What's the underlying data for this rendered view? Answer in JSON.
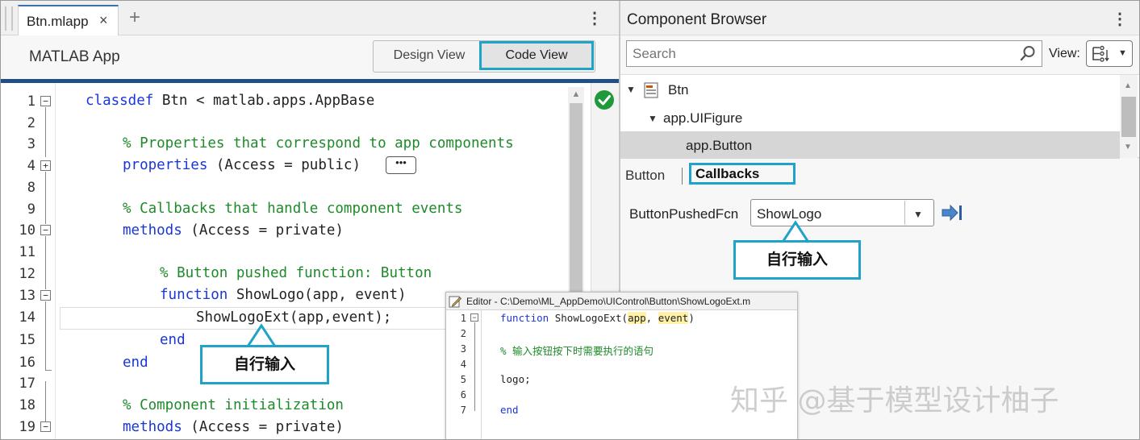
{
  "editor": {
    "tab_label": "Btn.mlapp",
    "tab_close": "×",
    "tab_add": "+",
    "tab_more": "⋮",
    "app_title": "MATLAB App",
    "design_view_label": "Design View",
    "code_view_label": "Code View",
    "ellipsis": "•••",
    "lines": [
      {
        "num": "1",
        "kw": "classdef",
        "text": " Btn < matlab.apps.AppBase",
        "comment": ""
      },
      {
        "num": "2",
        "kw": "",
        "text": "",
        "comment": ""
      },
      {
        "num": "3",
        "kw": "",
        "text": "",
        "comment": "% Properties that correspond to app components"
      },
      {
        "num": "4",
        "kw": "properties",
        "text": " (Access = public)",
        "comment": ""
      },
      {
        "num": "8",
        "kw": "",
        "text": "",
        "comment": ""
      },
      {
        "num": "9",
        "kw": "",
        "text": "",
        "comment": "% Callbacks that handle component events"
      },
      {
        "num": "10",
        "kw": "methods",
        "text": " (Access = private)",
        "comment": ""
      },
      {
        "num": "11",
        "kw": "",
        "text": "",
        "comment": ""
      },
      {
        "num": "12",
        "kw": "",
        "text": "",
        "comment": "% Button pushed function: Button"
      },
      {
        "num": "13",
        "kw": "function",
        "text": " ShowLogo(app, event)",
        "comment": ""
      },
      {
        "num": "14",
        "kw": "",
        "text": "ShowLogoExt(app,event);",
        "comment": ""
      },
      {
        "num": "15",
        "kw": "end",
        "text": "",
        "comment": ""
      },
      {
        "num": "16",
        "kw": "end",
        "text": "",
        "comment": ""
      },
      {
        "num": "17",
        "kw": "",
        "text": "",
        "comment": ""
      },
      {
        "num": "18",
        "kw": "",
        "text": "",
        "comment": "% Component initialization"
      },
      {
        "num": "19",
        "kw": "methods",
        "text": " (Access = private)",
        "comment": ""
      }
    ]
  },
  "component_browser": {
    "title": "Component Browser",
    "more": "⋮",
    "search_placeholder": "Search",
    "view_label": "View:",
    "tree": [
      {
        "label": "Btn"
      },
      {
        "label": "app.UIFigure"
      },
      {
        "label": "app.Button"
      }
    ],
    "tabs": {
      "button": "Button",
      "callbacks": "Callbacks"
    },
    "callback_label": "ButtonPushedFcn",
    "callback_value": "ShowLogo"
  },
  "callouts": {
    "left": "自行输入",
    "right": "自行输入"
  },
  "overlay_editor": {
    "title": "Editor - C:\\Demo\\ML_AppDemo\\UIControl\\Button\\ShowLogoExt.m",
    "line_numbers": [
      "1",
      "2",
      "3",
      "4",
      "5",
      "6",
      "7"
    ],
    "l1_kw": "function",
    "l1_name": " ShowLogoExt(",
    "l1_arg1": "app",
    "l1_sep": ", ",
    "l1_arg2": "event",
    "l1_close": ")",
    "l3": "% 输入按钮按下时需要执行的语句",
    "l5": "logo;",
    "l7": "end"
  },
  "watermark": "知乎 @基于模型设计柚子",
  "colors": {
    "accent": "#1fa3c9",
    "keyword": "#1a37d6",
    "comment": "#1e8a2a",
    "header_rule": "#1f4f86",
    "ok": "#1e9a3a"
  }
}
